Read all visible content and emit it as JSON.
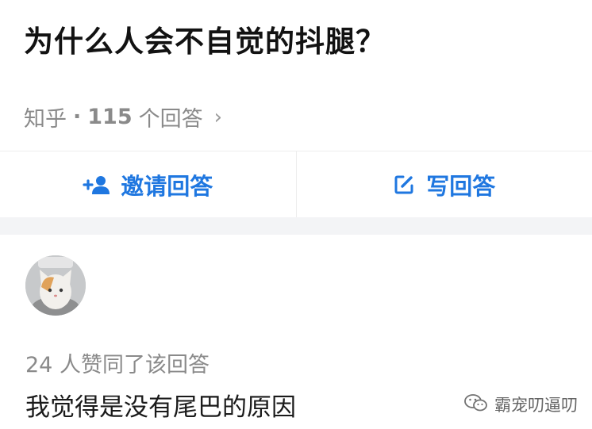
{
  "question": {
    "title": "为什么人会不自觉的抖腿？"
  },
  "meta": {
    "source": "知乎",
    "separator": "·",
    "answers_count": "115",
    "answers_label": "个回答",
    "chevron": "›"
  },
  "actions": {
    "invite_label": "邀请回答",
    "write_label": "写回答"
  },
  "answer": {
    "votes_text": "24 人赞同了该回答",
    "content": "我觉得是没有尾巴的原因"
  },
  "watermark": {
    "text": "霸宠叨逼叨"
  },
  "colors": {
    "accent": "#1f77e0",
    "muted": "#8a8a8a",
    "separator_band": "#f3f4f6"
  },
  "icons": {
    "invite": "add-person-icon",
    "write": "edit-icon",
    "watermark": "wechat-icon"
  }
}
